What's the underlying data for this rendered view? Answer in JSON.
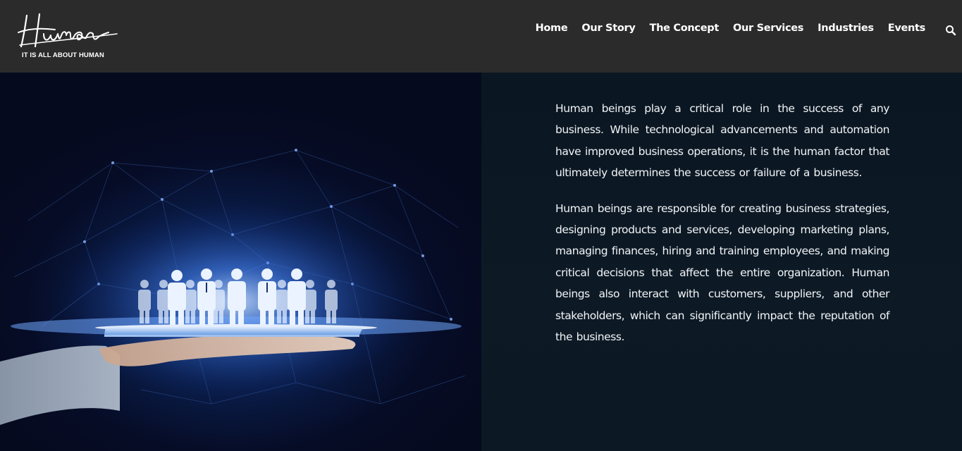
{
  "brand": {
    "logo_script": "Human",
    "tagline": "IT IS ALL ABOUT HUMAN"
  },
  "nav": {
    "items": [
      "Home",
      "Our Story",
      "The Concept",
      "Our Services",
      "Industries",
      "Events"
    ],
    "search_icon": "search-icon"
  },
  "hero": {
    "image": "hand-holding-tablet-with-people-icons"
  },
  "content": {
    "paragraphs": [
      "Human beings play a critical role in the success of any business. While technological advancements and automation have improved business operations, it is the human factor that ultimately determines the success or failure of a business.",
      "Human beings are responsible for creating business strategies, designing products and services, developing marketing plans, managing finances, hiring and training employees, and making critical decisions that affect the entire organization. Human beings also interact with customers, suppliers, and other stakeholders, which can significantly impact the reputation of the business."
    ]
  },
  "colors": {
    "header_bg": "#2b2b2b",
    "panel_bg": "#0b1520",
    "text": "#ffffff"
  }
}
